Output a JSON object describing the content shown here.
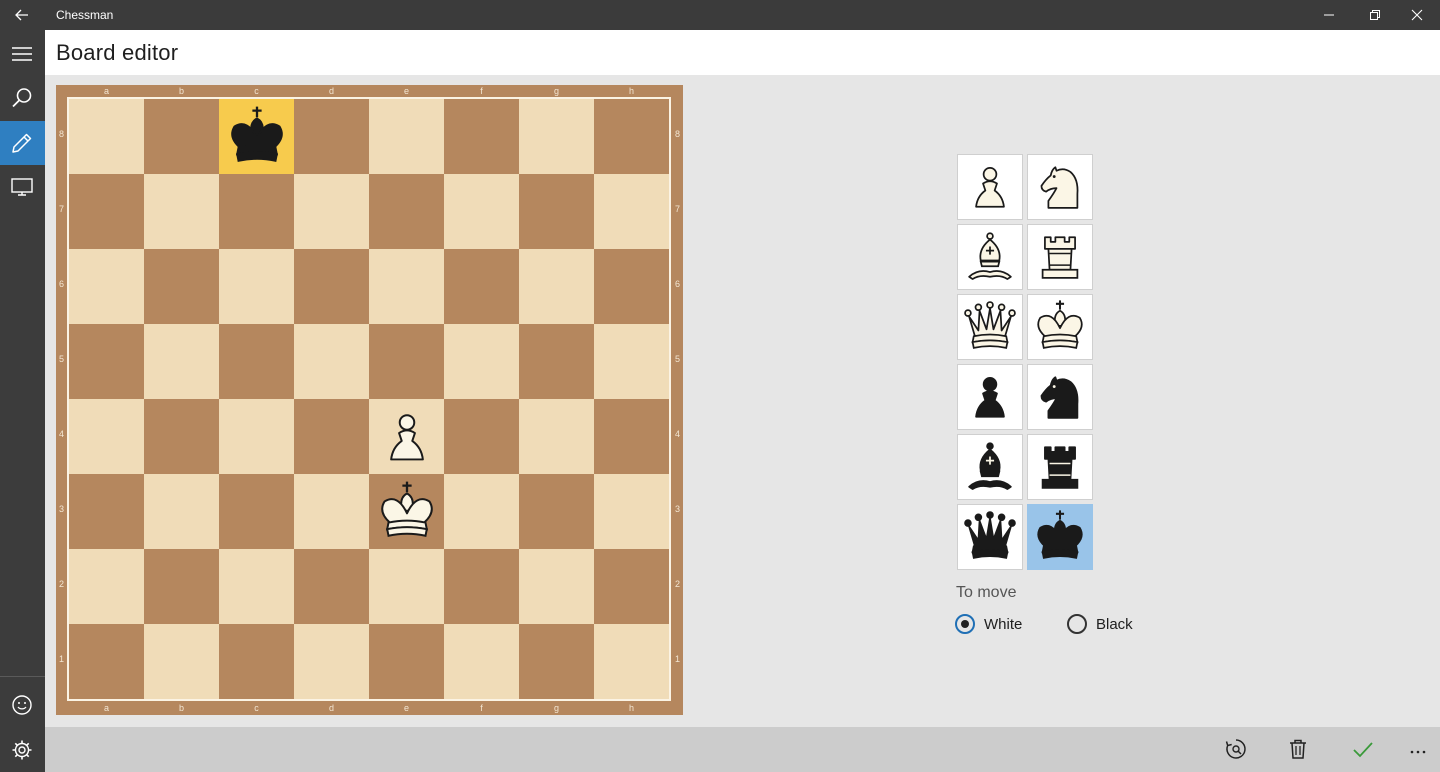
{
  "app": {
    "title": "Chessman"
  },
  "header": {
    "title": "Board editor"
  },
  "rail": {
    "items": [
      {
        "icon": "hamburger-icon"
      },
      {
        "icon": "search-icon"
      },
      {
        "icon": "edit-icon",
        "active": true
      },
      {
        "icon": "monitor-icon"
      }
    ],
    "bottom": [
      {
        "icon": "smiley-icon"
      },
      {
        "icon": "gear-icon"
      }
    ]
  },
  "board": {
    "files": [
      "a",
      "b",
      "c",
      "d",
      "e",
      "f",
      "g",
      "h"
    ],
    "ranks": [
      "8",
      "7",
      "6",
      "5",
      "4",
      "3",
      "2",
      "1"
    ],
    "highlight_square": "c8",
    "pieces": [
      {
        "square": "c8",
        "piece": "black-king"
      },
      {
        "square": "e4",
        "piece": "white-pawn"
      },
      {
        "square": "e3",
        "piece": "white-king"
      }
    ]
  },
  "palette": {
    "pieces": [
      "white-pawn",
      "white-knight",
      "white-bishop",
      "white-rook",
      "white-queen",
      "white-king",
      "black-pawn",
      "black-knight",
      "black-bishop",
      "black-rook",
      "black-queen",
      "black-king"
    ],
    "selected": "black-king"
  },
  "to_move": {
    "label": "To move",
    "white_label": "White",
    "black_label": "Black",
    "selected": "white"
  },
  "commands": [
    "rotate-board-icon",
    "delete-icon",
    "confirm-check-icon",
    "more-icon"
  ],
  "colors": {
    "light_square": "#f0dcb8",
    "dark_square": "#b5875e",
    "highlight": "#f7cb4d",
    "accent": "#2f7fc1",
    "selected_palette": "#99c4e9"
  }
}
